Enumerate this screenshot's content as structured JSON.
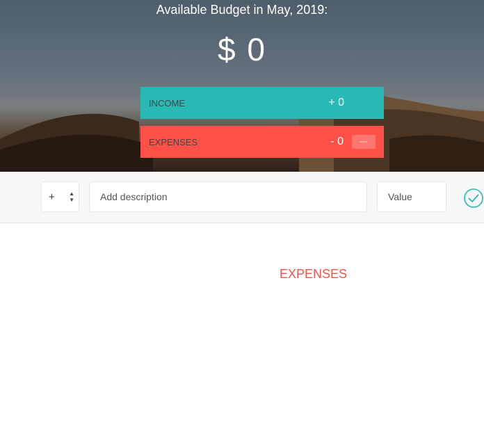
{
  "header": {
    "title": "Available Budget in May, 2019:",
    "budget_value": "$ 0"
  },
  "summary": {
    "income": {
      "label": "INCOME",
      "value": "+ 0"
    },
    "expenses": {
      "label": "EXPENSES",
      "value": "- 0",
      "percentage": "---"
    }
  },
  "add_bar": {
    "type_selected": "+",
    "description_placeholder": "Add description",
    "value_placeholder": "Value",
    "submit_icon": "check-circle-icon"
  },
  "lists": {
    "expenses_title": "EXPENSES"
  },
  "colors": {
    "income": "#28b9b5",
    "expenses": "#ff5049"
  }
}
